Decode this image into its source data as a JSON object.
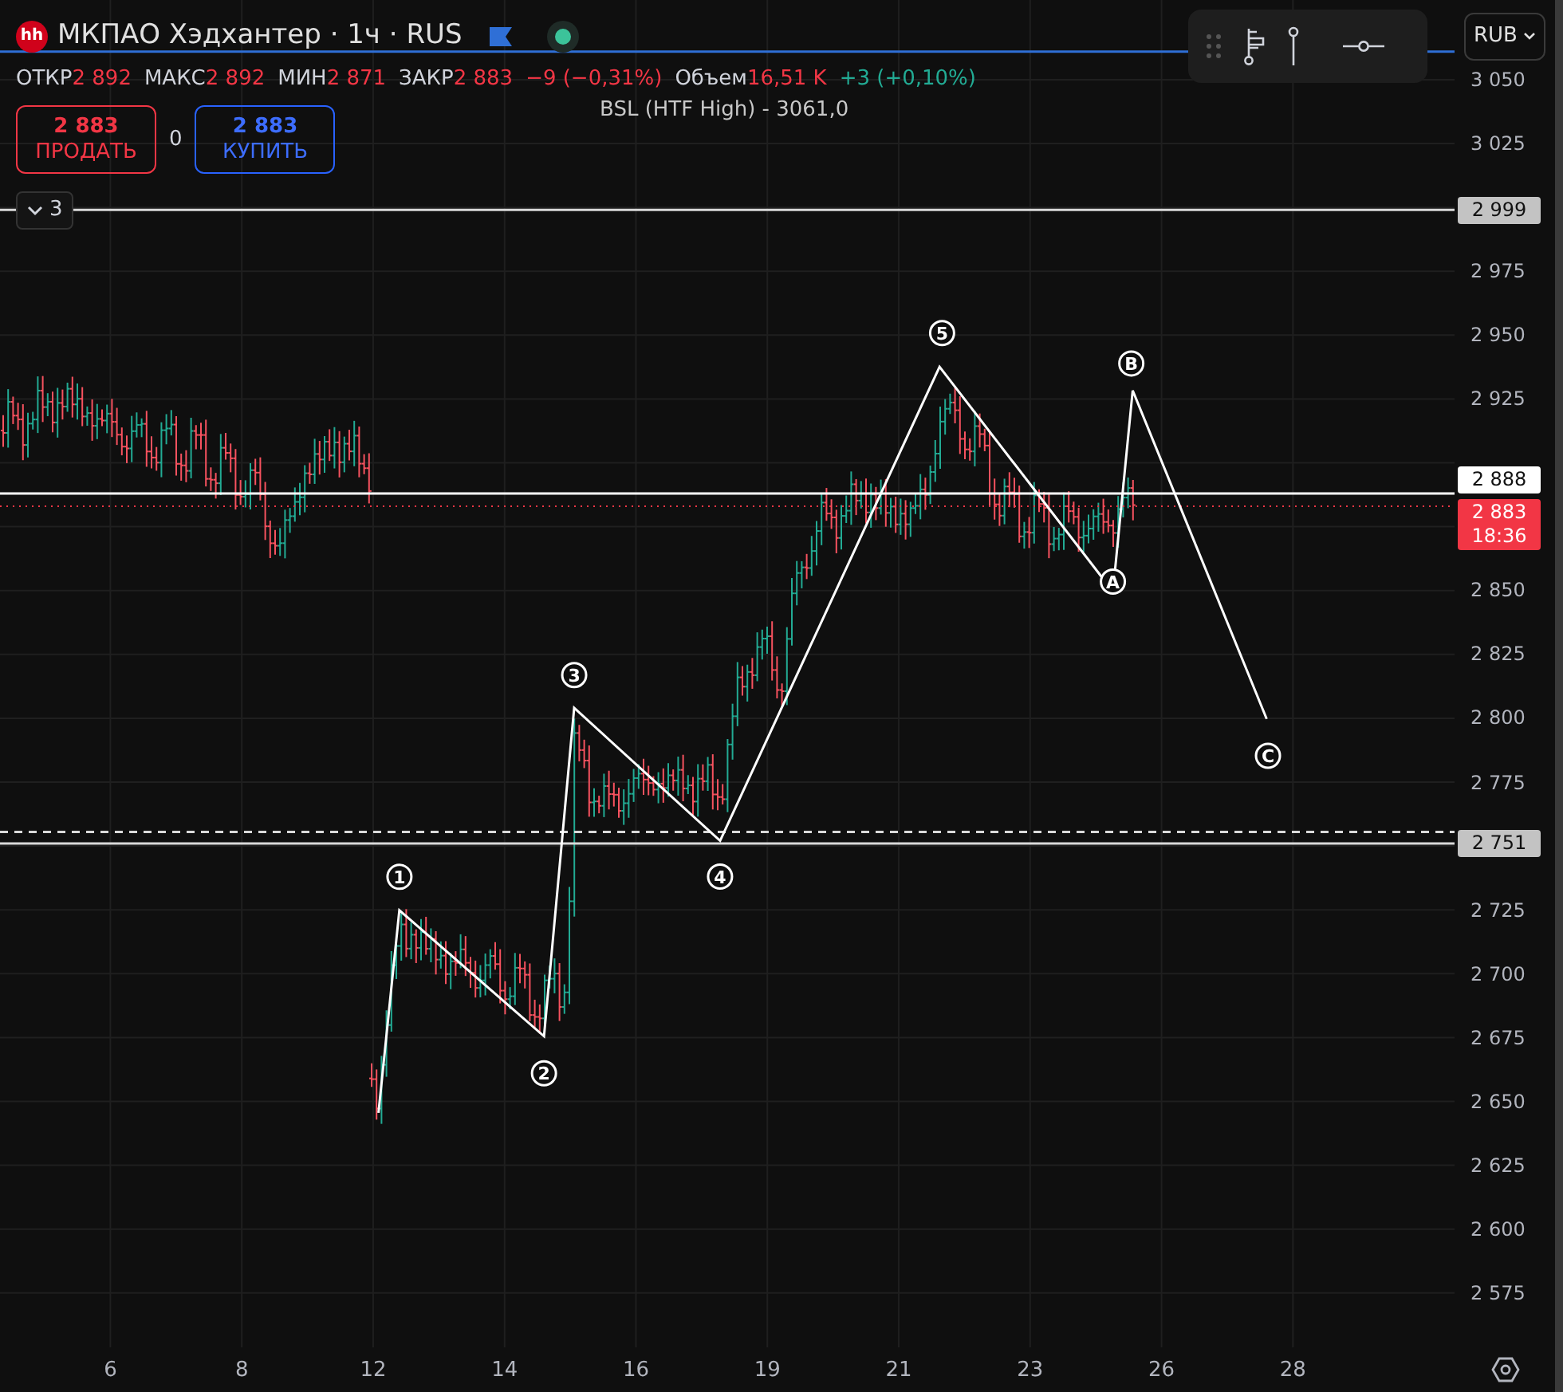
{
  "header": {
    "logo": "hh",
    "title": "МКПАО Хэдхантер · 1ч · RUS"
  },
  "ohlc": [
    {
      "label": "ОТКР",
      "value": "2 892"
    },
    {
      "label": "МАКС",
      "value": "2 892"
    },
    {
      "label": "МИН",
      "value": "2 871"
    },
    {
      "label": "ЗАКР",
      "value": "2 883"
    }
  ],
  "change": "−9 (−0,31%)",
  "volume": {
    "label": "Объем",
    "value": "16,51 K",
    "change": "+3 (+0,10%)"
  },
  "trade": {
    "sell": {
      "price": "2 883",
      "label": "ПРОДАТЬ"
    },
    "spread": "0",
    "buy": {
      "price": "2 883",
      "label": "КУПИТЬ"
    }
  },
  "indicators_toggle": {
    "count": "3"
  },
  "currency": "RUB",
  "price_scale": [
    "3 050",
    "3 025",
    "2 975",
    "2 950",
    "2 925",
    "2 850",
    "2 825",
    "2 800",
    "2 775",
    "2 725",
    "2 700",
    "2 675",
    "2 650",
    "2 625",
    "2 600",
    "2 575"
  ],
  "time_scale": [
    "6",
    "8",
    "12",
    "14",
    "16",
    "19",
    "21",
    "23",
    "26",
    "28"
  ],
  "wave_labels": [
    "1",
    "2",
    "3",
    "4",
    "5",
    "A",
    "B",
    "C"
  ],
  "levels": [
    {
      "kind": "labelled",
      "text": "BSL (HTF High) - 3061,0"
    },
    {
      "kind": "gray_tag",
      "text": "2 999"
    },
    {
      "kind": "white_tag",
      "text": "2 888"
    },
    {
      "kind": "last_tag",
      "text": "2 883",
      "countdown": "18:36"
    },
    {
      "kind": "plain"
    },
    {
      "kind": "gray_tag",
      "text": "2 751"
    }
  ]
}
